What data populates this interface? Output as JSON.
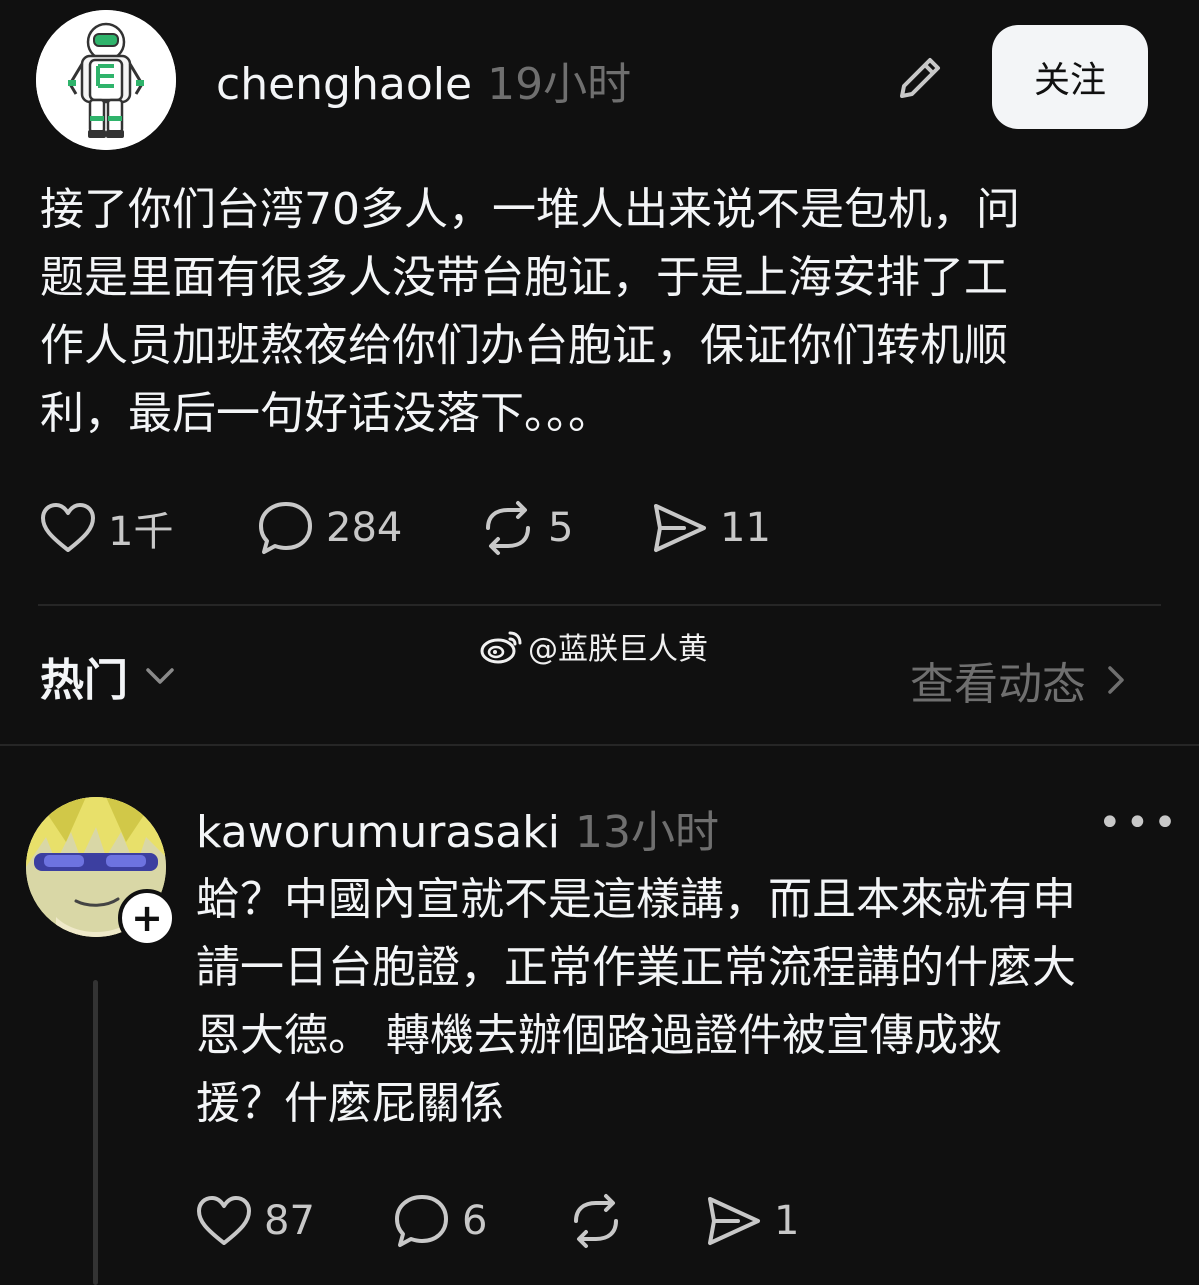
{
  "post": {
    "username": "chenghaole",
    "time": "19小时",
    "follow_label": "关注",
    "lines": [
      "接了你们台湾70多人，一堆人出来说不是包机，问",
      "题是里面有很多人没带台胞证，于是上海安排了工",
      "作人员加班熬夜给你们办台胞证，保证你们转机顺",
      "利，最后一句好话没落下。。。"
    ],
    "likes": "1千",
    "comments": "284",
    "reposts": "5",
    "shares": "11"
  },
  "sort": {
    "label": "热门",
    "view_activity": "查看动态"
  },
  "watermark": "@蓝朕巨人黄",
  "reply": {
    "username": "kaworumurasaki",
    "time": "13小时",
    "more": "•••",
    "plus": "+",
    "lines": [
      "蛤？中國內宣就不是這樣講，而且本來就有申",
      "請一日台胞證，正常作業正常流程講的什麼大",
      "恩大德。 轉機去辦個路過證件被宣傳成救",
      "援？什麼屁關係"
    ],
    "likes": "87",
    "comments": "6",
    "reposts": "",
    "shares": "1"
  },
  "icons": {
    "edit": "pencil-icon",
    "like": "heart-icon",
    "comment": "comment-icon",
    "repost": "repost-icon",
    "share": "send-icon",
    "chevron_down": "chevron-down-icon",
    "chevron_right": "chevron-right-icon",
    "weibo": "weibo-icon"
  }
}
